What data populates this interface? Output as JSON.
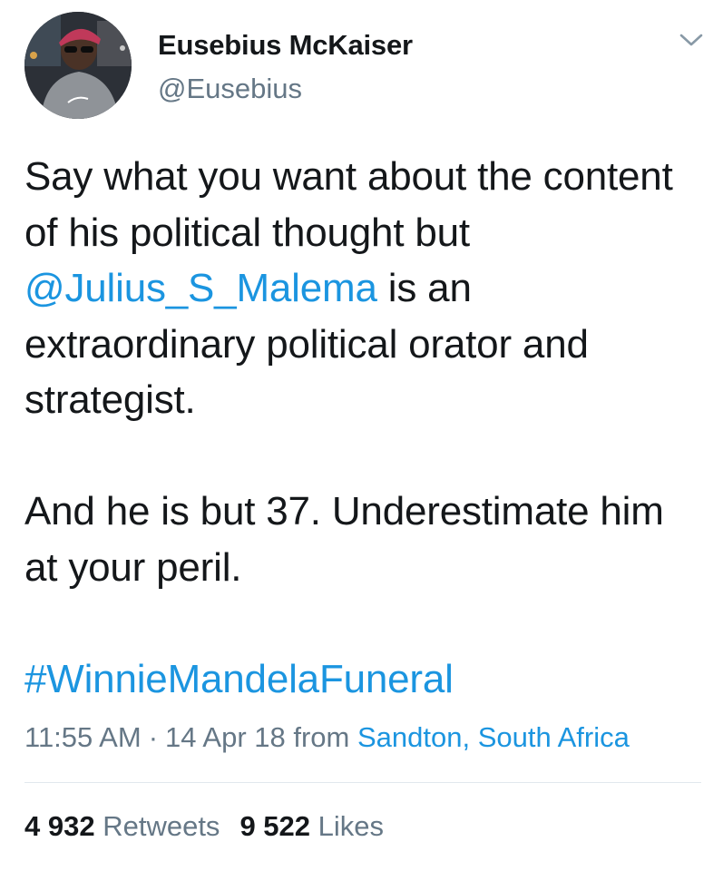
{
  "author": {
    "display_name": "Eusebius McKaiser",
    "handle": "@Eusebius",
    "avatar_icon": "profile-photo"
  },
  "menu": {
    "icon": "chevron-down-icon"
  },
  "tweet": {
    "para1_before": "Say what you want about the content of his political thought but ",
    "mention": "@Julius_S_Malema",
    "para1_after": " is an extraordinary political orator and strategist.",
    "para2": "And he is but 37. Underestimate him at your peril.",
    "hashtag": "#WinnieMandelaFuneral"
  },
  "meta": {
    "time": "11:55 AM",
    "separator": "·",
    "date": "14 Apr 18",
    "from_label": "from",
    "location": "Sandton, South Africa"
  },
  "stats": {
    "retweets_count": "4 932",
    "retweets_label": "Retweets",
    "likes_count": "9 522",
    "likes_label": "Likes"
  },
  "colors": {
    "link": "#1b95e0",
    "secondary_text": "#657786",
    "primary_text": "#14171a",
    "divider": "#e1e8ed"
  }
}
